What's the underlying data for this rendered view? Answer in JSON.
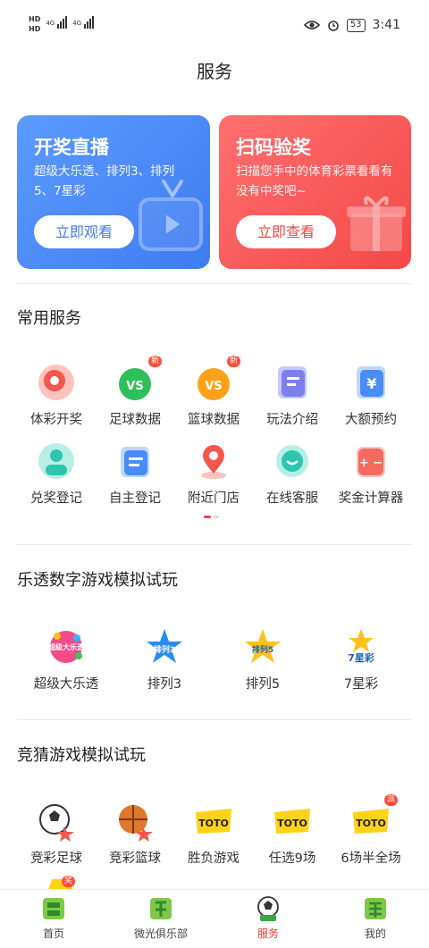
{
  "status": {
    "left1": "HD",
    "left2": "HD",
    "net1": "4G",
    "net2": "4G",
    "battery": "53",
    "time": "3:41"
  },
  "page_title": "服务",
  "banners": {
    "live": {
      "title": "开奖直播",
      "desc": "超级大乐透、排列3、排列5、7星彩",
      "button": "立即观看"
    },
    "scan": {
      "title": "扫码验奖",
      "desc": "扫描您手中的体育彩票看看有没有中奖吧~",
      "button": "立即查看"
    }
  },
  "common": {
    "title": "常用服务",
    "items": [
      {
        "label": "体彩开奖",
        "icon": "lottery-draw-icon"
      },
      {
        "label": "足球数据",
        "icon": "football-data-icon",
        "badge": "新"
      },
      {
        "label": "篮球数据",
        "icon": "basketball-data-icon",
        "badge": "新"
      },
      {
        "label": "玩法介绍",
        "icon": "rules-icon"
      },
      {
        "label": "大额预约",
        "icon": "large-reservation-icon"
      },
      {
        "label": "兑奖登记",
        "icon": "prize-register-icon"
      },
      {
        "label": "自主登记",
        "icon": "self-register-icon"
      },
      {
        "label": "附近门店",
        "icon": "nearby-store-icon"
      },
      {
        "label": "在线客服",
        "icon": "customer-service-icon"
      },
      {
        "label": "奖金计算器",
        "icon": "calculator-icon"
      }
    ]
  },
  "lotto": {
    "title": "乐透数字游戏模拟试玩",
    "items": [
      {
        "label": "超级大乐透",
        "logo": "超级大乐透"
      },
      {
        "label": "排列3",
        "logo": "排列3"
      },
      {
        "label": "排列5",
        "logo": "排列5"
      },
      {
        "label": "7星彩",
        "logo": "7星彩"
      }
    ]
  },
  "guess": {
    "title": "竞猜游戏模拟试玩",
    "items": [
      {
        "label": "竞彩足球",
        "icon": "football-icon"
      },
      {
        "label": "竞彩篮球",
        "icon": "basketball-icon"
      },
      {
        "label": "胜负游戏",
        "icon": "toto-icon",
        "logo": "TOTO"
      },
      {
        "label": "任选9场",
        "icon": "toto-icon",
        "logo": "TOTO"
      },
      {
        "label": "6场半全场",
        "icon": "toto-icon",
        "logo": "TOTO",
        "badge": "派"
      }
    ],
    "partial_badge": "奖"
  },
  "tabbar": [
    {
      "label": "首页",
      "icon": "home-icon"
    },
    {
      "label": "微光俱乐部",
      "icon": "club-icon"
    },
    {
      "label": "服务",
      "icon": "service-icon",
      "active": true
    },
    {
      "label": "我的",
      "icon": "profile-icon"
    }
  ],
  "colors": {
    "accent_red": "#e53e30",
    "banner_blue": "#4a86f5",
    "banner_red": "#f65555"
  }
}
